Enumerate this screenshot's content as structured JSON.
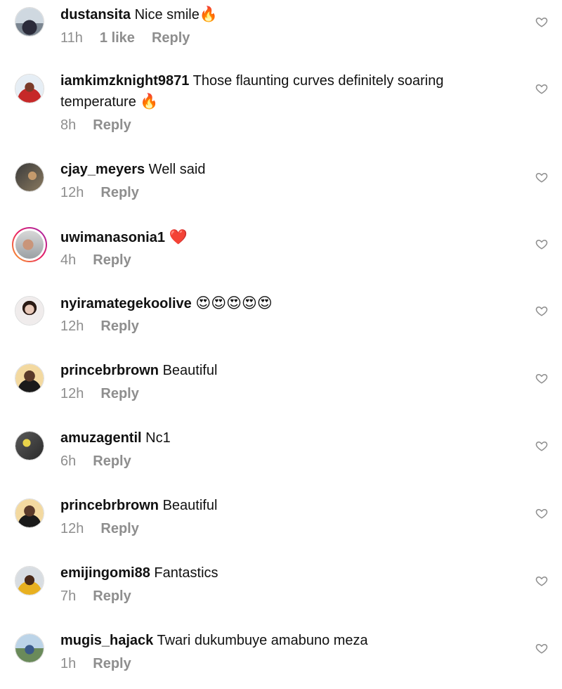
{
  "comments": [
    {
      "username": "dustansita",
      "text": "Nice smile",
      "emoji": "🔥",
      "time": "11h",
      "likes": "1 like",
      "reply": "Reply"
    },
    {
      "username": "iamkimzknight9871",
      "text": "Those flaunting curves definitely soaring",
      "text2": "temperature",
      "emoji": "🔥",
      "time": "8h",
      "reply": "Reply"
    },
    {
      "username": "cjay_meyers",
      "text": "Well said",
      "time": "12h",
      "reply": "Reply"
    },
    {
      "username": "uwimanasonia1",
      "text": "",
      "emoji": "❤️",
      "time": "4h",
      "reply": "Reply"
    },
    {
      "username": "nyiramategekoolive",
      "text": "",
      "emoji": "😍😍😍😍😍",
      "time": "12h",
      "reply": "Reply"
    },
    {
      "username": "princebrbrown",
      "text": "Beautiful",
      "time": "12h",
      "reply": "Reply"
    },
    {
      "username": "amuzagentil",
      "text": "Nc1",
      "time": "6h",
      "reply": "Reply"
    },
    {
      "username": "princebrbrown",
      "text": "Beautiful",
      "time": "12h",
      "reply": "Reply"
    },
    {
      "username": "emijingomi88",
      "text": "Fantastics",
      "time": "7h",
      "reply": "Reply"
    },
    {
      "username": "mugis_hajack",
      "text": "Twari dukumbuye amabuno meza",
      "time": "1h",
      "reply": "Reply"
    }
  ],
  "colors": {
    "meta": "#8e8e8e",
    "story_ring_start": "#f9a825",
    "story_ring_end": "#9c27b0"
  },
  "icons": {
    "like": "heart-outline-icon"
  }
}
